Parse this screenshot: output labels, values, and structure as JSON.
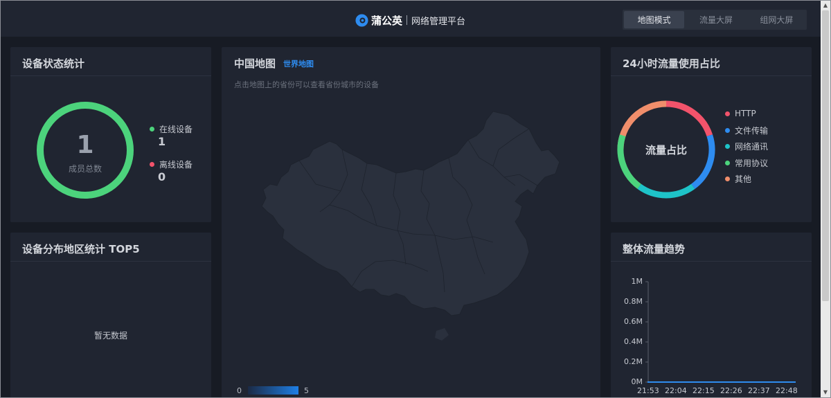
{
  "header": {
    "brand_name": "蒲公英",
    "brand_sub": "网络管理平台",
    "tabs": [
      {
        "label": "地图模式",
        "active": true
      },
      {
        "label": "流量大屏",
        "active": false
      },
      {
        "label": "组网大屏",
        "active": false
      }
    ]
  },
  "device_status": {
    "title": "设备状态统计",
    "total_value": "1",
    "total_label": "成员总数",
    "online_label": "在线设备",
    "online_value": "1",
    "offline_label": "离线设备",
    "offline_value": "0",
    "online_color": "#4cd37c",
    "offline_color": "#f2536b"
  },
  "region_top5": {
    "title": "设备分布地区统计 TOP5",
    "empty_text": "暂无数据"
  },
  "china_map": {
    "title": "中国地图",
    "world_link": "世界地图",
    "hint": "点击地图上的省份可以查看省份城市的设备",
    "scale_min": "0",
    "scale_max": "5"
  },
  "traffic_share": {
    "title": "24小时流量使用占比",
    "center_label": "流量占比",
    "legend": [
      {
        "label": "HTTP",
        "color": "#f2536b"
      },
      {
        "label": "文件传输",
        "color": "#2e8cf0"
      },
      {
        "label": "网络通讯",
        "color": "#1ec3c8"
      },
      {
        "label": "常用协议",
        "color": "#4cd37c"
      },
      {
        "label": "其他",
        "color": "#f08e6b"
      }
    ]
  },
  "traffic_trend": {
    "title": "整体流量趋势",
    "chart_data": {
      "type": "line",
      "x": [
        "21:53",
        "22:04",
        "22:15",
        "22:26",
        "22:37",
        "22:48"
      ],
      "y_ticks": [
        "1M",
        "0.8M",
        "0.6M",
        "0.4M",
        "0.2M",
        "0M"
      ],
      "ylim": [
        0,
        1
      ],
      "series": [
        {
          "values": [
            0,
            0,
            0,
            0,
            0,
            0
          ],
          "color": "#2e8cf0"
        }
      ]
    }
  }
}
